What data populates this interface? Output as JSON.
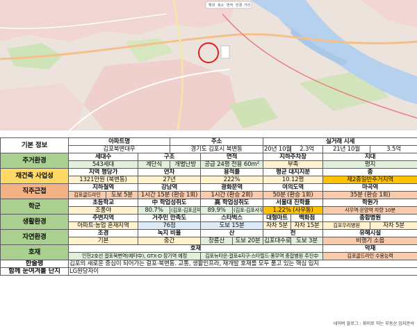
{
  "map": {
    "toolbar": [
      "확대",
      "축소",
      "면적",
      "반경",
      "거리"
    ]
  },
  "basic": {
    "section": "기본 정보",
    "apt_label": "아파트명",
    "apt_value": "김포북변대우",
    "addr_label": "주소",
    "addr_value": "경기도 김포시 북변동",
    "price_label": "실거래 시세",
    "p1_date": "20년 10월",
    "p1_val": "2.3억",
    "p2_date": "21년 10월",
    "p2_val": "3.5억"
  },
  "living": {
    "section": "주거환경",
    "h": [
      "세대수",
      "구조",
      "면적",
      "지하주차장",
      "지대"
    ],
    "households": "543세대",
    "structure": "계단식",
    "heating": "개별난방",
    "area": "공급 24평  전용 60m²",
    "parking": "부족",
    "terrain": "평지"
  },
  "rebuild": {
    "section": "재건축 사업성",
    "h": [
      "지역 평당가",
      "연차",
      "용적률",
      "평균 대지지분",
      "종"
    ],
    "price": "1321만원 (북변동)",
    "age": "27년",
    "far": "222%",
    "land": "10.12평",
    "zone": "제2종일반주거지역"
  },
  "commute": {
    "section": "직주근접",
    "h": [
      "지하철역",
      "강남역",
      "광화문역",
      "여의도역",
      "마곡역"
    ],
    "station": "김포골드라인",
    "walk": "도보 5분",
    "gangnam": "1시간 15분 (환승 1회)",
    "gwanghwamun": "1시간 (환승 2회)",
    "yeouido": "50분 (환승 1회)",
    "magok": "35분 (환승 1회)"
  },
  "school": {
    "section": "학군",
    "h": [
      "초등학교",
      "中 학업성취도",
      "高 학업성취도",
      "서울대 진학률",
      "학원가"
    ],
    "elementary": "조품야",
    "mid_score": "80.7%",
    "mid_school": "(김포-김포금파)",
    "high_score": "89.9%",
    "high_school": "(김포-김포사우)",
    "snu_rate": "1.22% (사우동)",
    "academy": "사우역·운양역  차량 10분"
  },
  "life": {
    "section": "생활환경",
    "h": [
      "주변지역",
      "거주민 만족도",
      "스타벅스",
      "대형마트",
      "백화점",
      "종합병원"
    ],
    "area": "아파트·농업 혼재지역",
    "satisfaction": "76점",
    "starbucks": "도보 15분",
    "mart": "자차 5분",
    "dept": "자차 15분",
    "hospital": "김포우리병원",
    "hospital_time": "자차 5분"
  },
  "nature": {
    "section": "자연환경",
    "h": [
      "조경",
      "녹지 비율",
      "산",
      "천",
      "유해시설"
    ],
    "landscape": "기본",
    "green": "중간",
    "mountain": "장릉산",
    "mountain_time": "도보 20분",
    "stream": "김포대수로",
    "stream_time": "도보 3분",
    "hazard": "비행기 소음"
  },
  "good": {
    "section": "호재",
    "h1": "호재",
    "h2": "악재",
    "item1": "인천2호선 걸포북변역(예타中), GTX-D 장기역 예정",
    "item2": "김포뉴타운·걸포4지구·스타필드·풍무역 종합병원 추진中",
    "bad": "김포골드라인 수용능력"
  },
  "summary": {
    "label": "한줄평",
    "text": "김포의 새로운 중심이 되어가는 걸포·북변동. 교통, 생활인프라, 재개발 호재를 모두 품고 있는 핵심 입지"
  },
  "together": {
    "label": "함께 눈여겨볼 단지",
    "text": "LG원당자이"
  },
  "caption": "네이버 블로그 : 취미로 하는 부동산 입지분석"
}
